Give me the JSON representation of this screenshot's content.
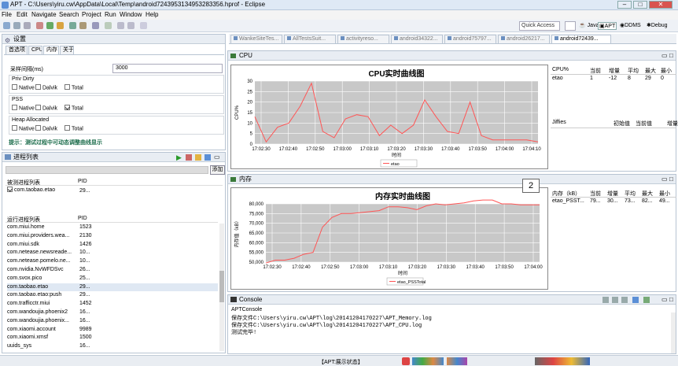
{
  "window": {
    "title": "APT - C:\\Users\\yiru.cw\\AppData\\Local\\Temp\\android7243953134953283356.hprof - Eclipse"
  },
  "menu": [
    "File",
    "Edit",
    "Navigate",
    "Search",
    "Project",
    "Run",
    "Window",
    "Help"
  ],
  "toolbar": {
    "quick_access": "Quick Access",
    "perspectives": [
      "Java",
      "APT",
      "DDMS",
      "Debug"
    ]
  },
  "settings": {
    "title": "设置",
    "tabs": [
      "首选项",
      "CPU",
      "内存",
      "关于"
    ],
    "active_tab": "内存",
    "interval_label": "采样间隔(ms)",
    "interval_value": "3000",
    "groups": [
      {
        "title": "Priv Dirty",
        "options": [
          {
            "label": "Native",
            "checked": false
          },
          {
            "label": "Dalvik",
            "checked": false
          },
          {
            "label": "Total",
            "checked": false
          }
        ]
      },
      {
        "title": "PSS",
        "options": [
          {
            "label": "Native",
            "checked": false
          },
          {
            "label": "Dalvik",
            "checked": false
          },
          {
            "label": "Total",
            "checked": true
          }
        ]
      },
      {
        "title": "Heap Allocated",
        "options": [
          {
            "label": "Native",
            "checked": false
          },
          {
            "label": "Dalvik",
            "checked": false
          },
          {
            "label": "Total",
            "checked": false
          }
        ]
      }
    ],
    "hint": "提示：测试过程中可动态调整曲线显示"
  },
  "process": {
    "title": "进程列表",
    "add_button": "添加",
    "monitored_header": "被测进程列表",
    "pid_header": "PID",
    "monitored": [
      {
        "name": "com.taobao.etao",
        "pid": "29..."
      }
    ],
    "running_header": "运行进程列表",
    "running": [
      {
        "name": "com.miui.home",
        "pid": "1523"
      },
      {
        "name": "com.miui.providers.wea...",
        "pid": "2130"
      },
      {
        "name": "com.miui.sdk",
        "pid": "1426"
      },
      {
        "name": "com.netease.newsreade...",
        "pid": "10..."
      },
      {
        "name": "com.netease.pomelo.ne...",
        "pid": "10..."
      },
      {
        "name": "com.nvidia.NvWFDSvc",
        "pid": "26..."
      },
      {
        "name": "com.svox.pico",
        "pid": "25..."
      },
      {
        "name": "com.taobao.etao",
        "pid": "29..."
      },
      {
        "name": "com.taobao.etao:push",
        "pid": "29..."
      },
      {
        "name": "com.trafficctr.miui",
        "pid": "1452"
      },
      {
        "name": "com.wandoujia.phoenix2",
        "pid": "16..."
      },
      {
        "name": "com.wandoujia.phoenix...",
        "pid": "16..."
      },
      {
        "name": "com.xiaomi.account",
        "pid": "9989"
      },
      {
        "name": "com.xiaomi.xmsf",
        "pid": "1500"
      },
      {
        "name": "uuids_sys",
        "pid": "16..."
      }
    ]
  },
  "editor_tabs": [
    "WankeSiteTes...",
    "AllTestsSuit...",
    "activityreso...",
    "android34322...",
    "android75797...",
    "android26217...",
    "android72439..."
  ],
  "cpu": {
    "view_title": "CPU",
    "table_headers": [
      "CPU%",
      "当前",
      "增量",
      "平均",
      "最大",
      "最小"
    ],
    "table_row": [
      "etao",
      "1",
      "-12",
      "8",
      "29",
      "0"
    ],
    "jiffies_headers": [
      "Jiffies",
      "初始值",
      "当前值",
      "增量"
    ]
  },
  "memory": {
    "view_title": "内存",
    "badge": "2",
    "table_headers": [
      "内存（kB）",
      "当前",
      "增量",
      "平均",
      "最大",
      "最小"
    ],
    "table_row": [
      "etao_PSST...",
      "79...",
      "30...",
      "73...",
      "82...",
      "49..."
    ]
  },
  "console": {
    "title": "Console",
    "name": "APTConsole",
    "lines": [
      "保存文件C:\\Users\\yiru.cw\\APT\\log\\20141204170227\\APT_Memory.log",
      "保存文件C:\\Users\\yiru.cw\\APT\\log\\20141204170227\\APT_CPU.log",
      "测试完毕!"
    ]
  },
  "status": {
    "text": "【APT:展示状态】"
  },
  "chart_data": [
    {
      "type": "line",
      "title": "CPU实时曲线图",
      "xlabel": "时间",
      "ylabel": "CPU%",
      "x": [
        "17:02:30",
        "17:02:40",
        "17:02:50",
        "17:03:00",
        "17:03:10",
        "17:03:20",
        "17:03:30",
        "17:03:40",
        "17:03:50",
        "17:04:00",
        "17:04:10"
      ],
      "ylim": [
        0,
        30
      ],
      "yticks": [
        0,
        5,
        10,
        15,
        20,
        25,
        30
      ],
      "grid": true,
      "legend": "bottom",
      "series": [
        {
          "name": "etao",
          "color": "#ff5555",
          "values": [
            13,
            1,
            8,
            10,
            18,
            29,
            6,
            3,
            12,
            14,
            13,
            4,
            9,
            5,
            9,
            21,
            13,
            6,
            5,
            20,
            4,
            2,
            2,
            2,
            2,
            1
          ]
        }
      ]
    },
    {
      "type": "line",
      "title": "内存实时曲线图",
      "xlabel": "时间",
      "ylabel": "内存值（kB）",
      "x": [
        "17:02:30",
        "17:02:40",
        "17:02:50",
        "17:03:00",
        "17:03:10",
        "17:03:20",
        "17:03:30",
        "17:03:40",
        "17:03:50",
        "17:04:00"
      ],
      "ylim": [
        50000,
        80000
      ],
      "yticks": [
        50000,
        55000,
        60000,
        65000,
        70000,
        75000,
        80000
      ],
      "grid": true,
      "legend": "bottom",
      "series": [
        {
          "name": "etao_PSSTotal",
          "color": "#ff5555",
          "values": [
            49500,
            51000,
            51000,
            52000,
            54000,
            55000,
            68000,
            73000,
            75000,
            75000,
            75500,
            76000,
            76500,
            78500,
            78500,
            78000,
            77000,
            79000,
            80000,
            79500,
            80000,
            80500,
            81500,
            82000,
            82000,
            80000,
            80000,
            79500,
            79500,
            79500
          ]
        }
      ]
    }
  ]
}
